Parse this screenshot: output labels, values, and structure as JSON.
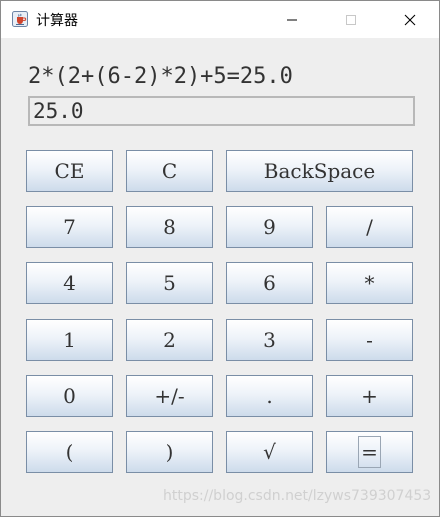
{
  "window": {
    "title": "计算器",
    "icon": "java-coffee-cup-icon"
  },
  "controls": {
    "minimize_icon": "minimize-icon",
    "maximize_icon": "maximize-icon",
    "close_icon": "close-icon"
  },
  "calculator": {
    "expression": "2*(2+(6-2)*2)+5=25.0",
    "display_value": "25.0"
  },
  "buttons": {
    "ce": "CE",
    "c": "C",
    "backspace": "BackSpace",
    "seven": "7",
    "eight": "8",
    "nine": "9",
    "divide": "/",
    "four": "4",
    "five": "5",
    "six": "6",
    "multiply": "*",
    "one": "1",
    "two": "2",
    "three": "3",
    "minus": "-",
    "zero": "0",
    "sign": "+/-",
    "dot": ".",
    "plus": "+",
    "lparen": "(",
    "rparen": ")",
    "sqrt": "√",
    "equals": "="
  },
  "watermark": "https://blog.csdn.net/lzyws739307453"
}
